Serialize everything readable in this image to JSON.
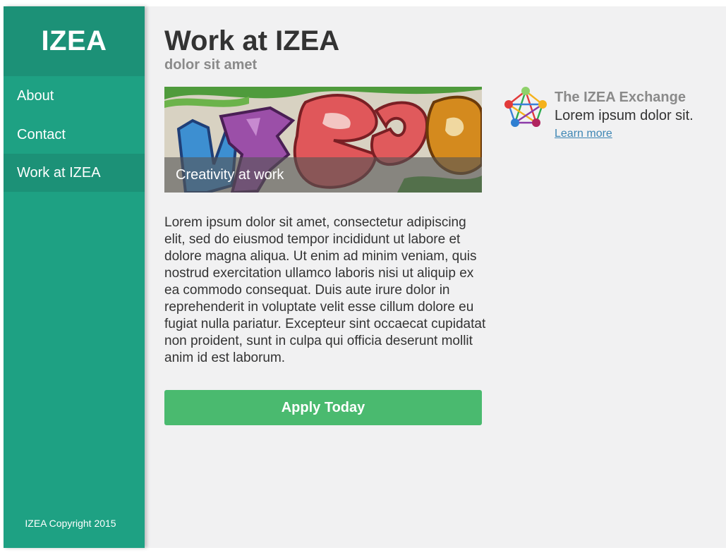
{
  "sidebar": {
    "brand": "IZEA",
    "nav": [
      {
        "label": "About"
      },
      {
        "label": "Contact"
      },
      {
        "label": "Work at IZEA",
        "active": true
      }
    ],
    "copyright": "IZEA Copyright 2015"
  },
  "main": {
    "title": "Work at IZEA",
    "subtitle": "dolor sit amet",
    "hero_caption": "Creativity at work",
    "body": "Lorem ipsum dolor sit amet, consectetur adipiscing elit, sed do eiusmod tempor incididunt ut labore et dolore magna aliqua. Ut enim ad minim veniam, quis nostrud exercitation ullamco laboris nisi ut aliquip ex ea commodo consequat. Duis aute irure dolor in reprehenderit in voluptate velit esse cillum dolore eu fugiat nulla pariatur. Excepteur sint occaecat cupidatat non proident, sunt in culpa qui officia deserunt mollit anim id est laborum.",
    "apply_button": "Apply Today"
  },
  "promo": {
    "title": "The IZEA Exchange",
    "text": "Lorem ipsum dolor sit.",
    "link": "Learn more",
    "icon": "izea-exchange-logo-icon"
  },
  "colors": {
    "sidebar": "#1ea183",
    "sidebar_dark": "#1c9177",
    "page_background": "#f1f1f2",
    "button": "#4aba6f",
    "link": "#3e86b4",
    "heading": "#333333",
    "muted": "#8a8a8a"
  }
}
